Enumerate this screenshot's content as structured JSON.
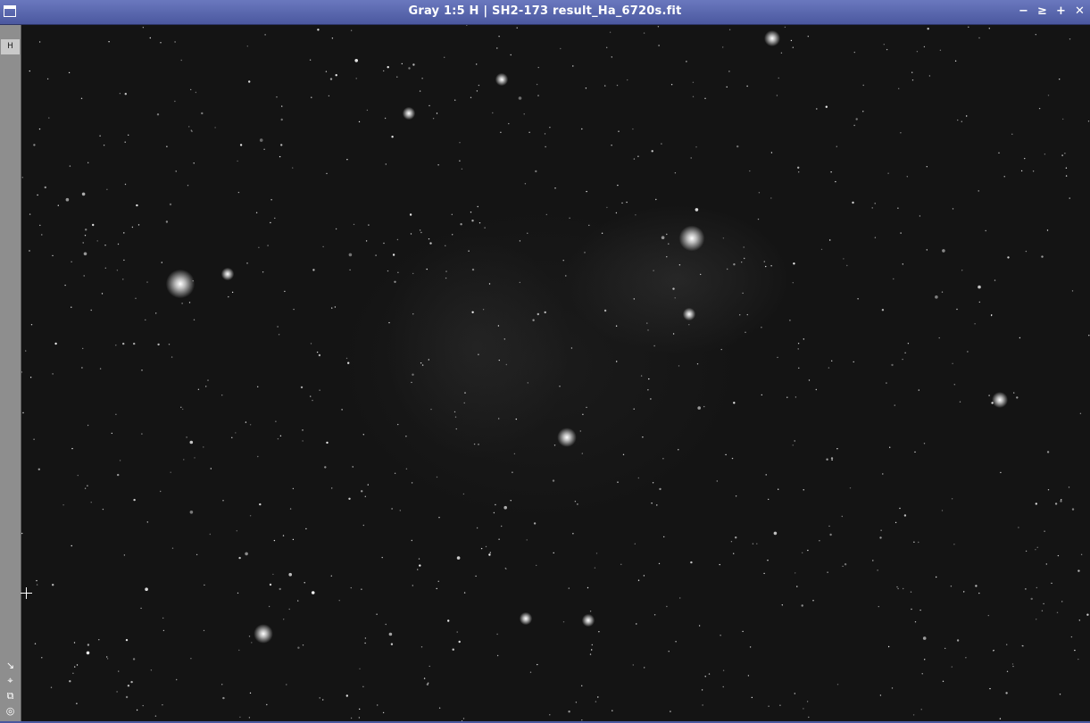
{
  "window": {
    "title": "Gray 1:5 H | SH2-173 result_Ha_6720s.fit",
    "controls": {
      "minimize": "−",
      "shade": "≥",
      "maximize": "+",
      "close": "✕"
    }
  },
  "sidebar": {
    "tab_label": "H",
    "tools": [
      {
        "icon": "fit-view-icon",
        "glyph": "↘"
      },
      {
        "icon": "crop-icon",
        "glyph": "⌖"
      },
      {
        "icon": "clone-icon",
        "glyph": "⧉"
      },
      {
        "icon": "target-icon",
        "glyph": "◎"
      }
    ]
  },
  "image": {
    "object": "SH2-173",
    "channel": "H",
    "zoom": "1:5",
    "color_space": "Gray"
  }
}
